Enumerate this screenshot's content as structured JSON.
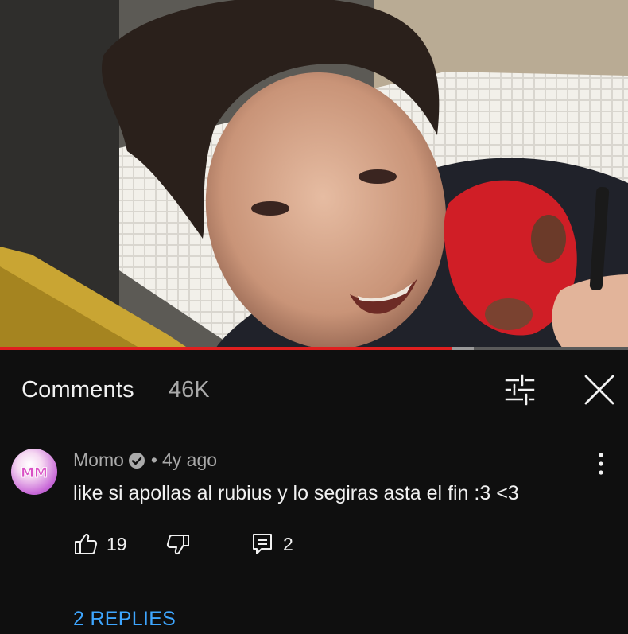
{
  "video": {
    "progress_fraction": 0.72,
    "buffered_fraction": 0.755
  },
  "comments_header": {
    "title": "Comments",
    "count": "46K",
    "filter_icon": "sort-filter-icon",
    "close_icon": "close-icon"
  },
  "comment": {
    "avatar_icon": "avatar",
    "author": "Momo",
    "verified_icon": "verified-check-icon",
    "separator": "•",
    "age": "4y ago",
    "text": "like si apollas al rubius y lo segiras asta el fin :3 <3",
    "more_icon": "more-vert-icon",
    "likes": "19",
    "replies_count": "2",
    "replies_link": "2 REPLIES"
  },
  "colors": {
    "background": "#0f0f0f",
    "progress": "#e01f1f",
    "link": "#3ea6ff",
    "secondary_text": "#aaaaaa"
  }
}
